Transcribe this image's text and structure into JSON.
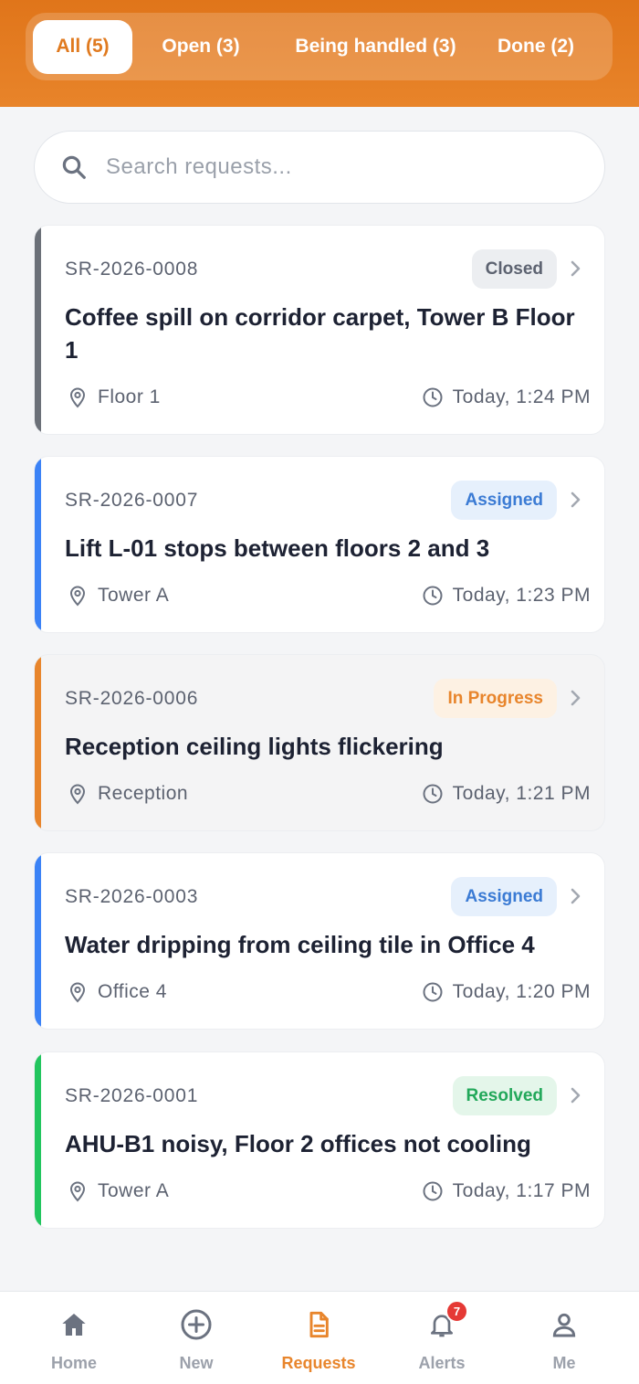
{
  "tabs": [
    {
      "label": "All (5)",
      "active": true
    },
    {
      "label": "Open (3)",
      "active": false
    },
    {
      "label": "Being handled (3)",
      "active": false
    },
    {
      "label": "Done (2)",
      "active": false
    }
  ],
  "search": {
    "placeholder": "Search requests...",
    "value": ""
  },
  "requests": [
    {
      "id": "SR-2026-0008",
      "status": "Closed",
      "title": "Coffee spill on corridor carpet, Tower B Floor 1",
      "location": "Floor 1",
      "time": "Today, 1:24 PM",
      "accent": "#6b7078"
    },
    {
      "id": "SR-2026-0007",
      "status": "Assigned",
      "title": "Lift L-01 stops between floors 2 and 3",
      "location": "Tower A",
      "time": "Today, 1:23 PM",
      "accent": "#3b82f6"
    },
    {
      "id": "SR-2026-0006",
      "status": "In Progress",
      "title": "Reception ceiling lights flickering",
      "location": "Reception",
      "time": "Today, 1:21 PM",
      "accent": "#e8852c"
    },
    {
      "id": "SR-2026-0003",
      "status": "Assigned",
      "title": "Water dripping from ceiling tile in Office 4",
      "location": "Office 4",
      "time": "Today, 1:20 PM",
      "accent": "#3b82f6"
    },
    {
      "id": "SR-2026-0001",
      "status": "Resolved",
      "title": "AHU-B1 noisy, Floor 2 offices not cooling",
      "location": "Tower A",
      "time": "Today, 1:17 PM",
      "accent": "#22c55e"
    }
  ],
  "status_colors": {
    "Closed": {
      "bg": "#eceef1",
      "fg": "#5c6270"
    },
    "Assigned": {
      "bg": "#e6f0fc",
      "fg": "#3b7bd4"
    },
    "In Progress": {
      "bg": "#fdf1e3",
      "fg": "#e8852c"
    },
    "Resolved": {
      "bg": "#e4f6ea",
      "fg": "#22a85a"
    }
  },
  "nav": [
    {
      "label": "Home",
      "icon": "home-icon",
      "active": false
    },
    {
      "label": "New",
      "icon": "plus-circle-icon",
      "active": false
    },
    {
      "label": "Requests",
      "icon": "document-icon",
      "active": true
    },
    {
      "label": "Alerts",
      "icon": "bell-icon",
      "active": false,
      "badge": "7"
    },
    {
      "label": "Me",
      "icon": "user-icon",
      "active": false
    }
  ],
  "colors": {
    "brand": "#e8852c",
    "brand_dark": "#e0751a"
  }
}
